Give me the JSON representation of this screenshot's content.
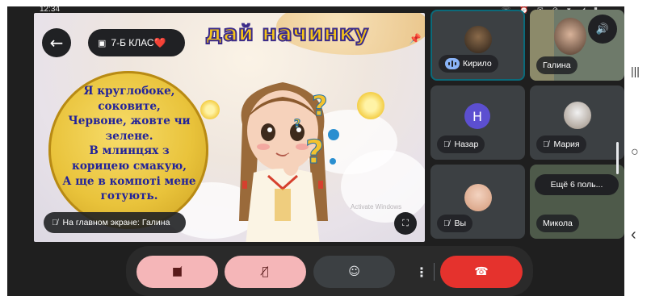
{
  "status_bar": {
    "time": "12:34",
    "icons": "☏ ⏰ ✉ ⊘ ▾ ◢ ▮"
  },
  "header": {
    "back_icon": "arrow-left-icon",
    "room_name": "7-Б КЛАС❤️",
    "calendar_icon": "calendar-icon"
  },
  "presentation": {
    "title_visible": "дай начинку",
    "riddle_lines": [
      "Я круглобоке,",
      "соковите,",
      "Червоне, жовте чи",
      "зелене.",
      "В млинцях з",
      "корицею смакую,",
      "А ще в компоті мене",
      "готують."
    ],
    "watermark": "Activate Windows",
    "presenter_label": "На главном экране: Галина",
    "pin_icon": "pin-icon",
    "fullscreen_icon": "fullscreen-icon"
  },
  "participants": [
    {
      "name": "Кирило",
      "muted": false,
      "speaking": true
    },
    {
      "name": "Галина",
      "muted": false,
      "speaking": false
    },
    {
      "name": "Назар",
      "initial": "Н",
      "muted": true,
      "avatar_color": "#5c4fd0"
    },
    {
      "name": "Мария",
      "muted": true
    },
    {
      "name": "Вы",
      "muted": true
    },
    {
      "name": "Микола",
      "muted": false
    }
  ],
  "more_participants": "Ещё 6 поль...",
  "controls": {
    "camera_off_icon": "camera-off-icon",
    "mic_off_icon": "mic-off-icon",
    "emoji_icon": "emoji-icon",
    "more_icon": "more-vert-icon",
    "hangup_icon": "hangup-icon"
  },
  "system_nav": {
    "recents": "|||",
    "home": "○",
    "back": "‹"
  },
  "colors": {
    "accent_pink": "#f5b6b8",
    "hangup_red": "#e5322d",
    "tile_bg": "#3c4043",
    "background": "#1f1f1f"
  }
}
